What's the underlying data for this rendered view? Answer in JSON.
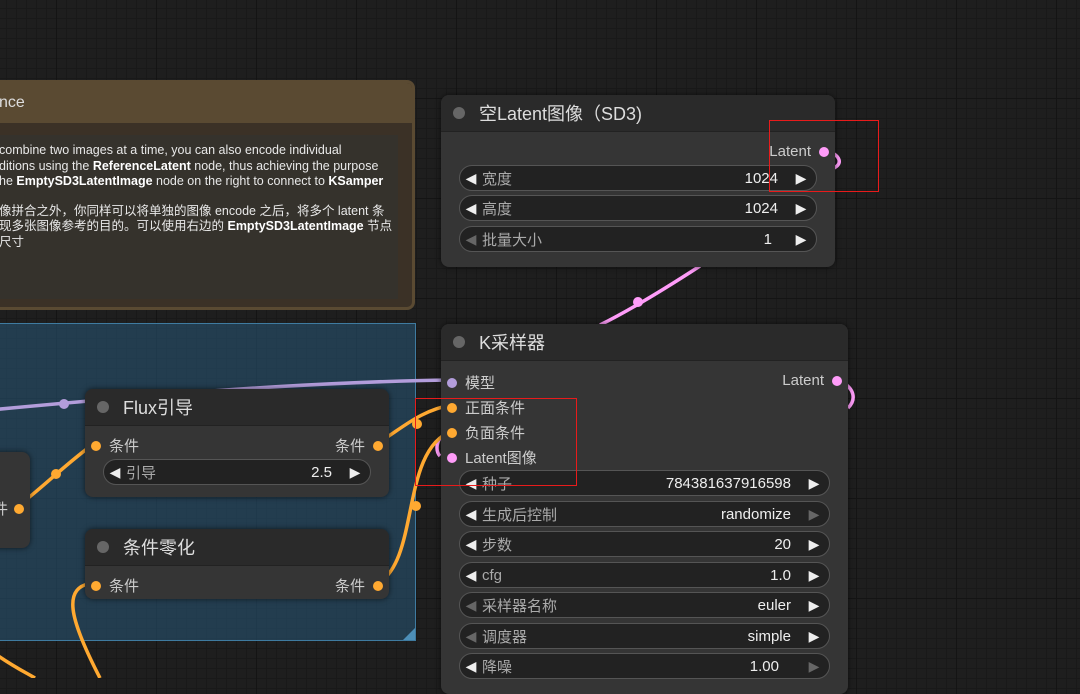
{
  "note": {
    "title": "nce",
    "en_lines": [
      " combine two images at a time, you can also encode individual",
      "ditions using the ",
      "he ",
      "node on the right to connect to "
    ],
    "en_bold": [
      "ReferenceLatent",
      "EmptySD3LatentImage",
      "KSamper"
    ],
    "en_line2_tail": " node, thus achieving the purpose",
    "zh_line1": "像拼合之外，你同样可以将单独的图像 encode 之后，将多个 latent 条",
    "zh_line2_pre": "现多张图像参考的目的。可以使用右边的 ",
    "zh_line2_bold": "EmptySD3LatentImage",
    "zh_line2_tail": " 节点",
    "zh_line3": "尺寸"
  },
  "empty_latent": {
    "title": "空Latent图像（SD3)",
    "output_label": "Latent",
    "widgets": [
      {
        "label": "宽度",
        "value": "1024"
      },
      {
        "label": "高度",
        "value": "1024"
      },
      {
        "label": "批量大小",
        "value": "1"
      }
    ]
  },
  "ksampler": {
    "title": "K采样器",
    "inputs": [
      "模型",
      "正面条件",
      "负面条件",
      "Latent图像"
    ],
    "output_label": "Latent",
    "widgets": [
      {
        "label": "种子",
        "value": "784381637916598"
      },
      {
        "label": "生成后控制",
        "value": "randomize"
      },
      {
        "label": "步数",
        "value": "20"
      },
      {
        "label": "cfg",
        "value": "1.0"
      },
      {
        "label": "采样器名称",
        "value": "euler"
      },
      {
        "label": "调度器",
        "value": "simple"
      },
      {
        "label": "降噪",
        "value": "1.00"
      }
    ]
  },
  "flux_guidance": {
    "title": "Flux引导",
    "input_label": "条件",
    "output_label": "条件",
    "widget": {
      "label": "引导",
      "value": "2.5"
    }
  },
  "cond_zero": {
    "title": "条件零化",
    "input_label": "条件",
    "output_label": "条件"
  },
  "partial_node": {
    "output_label": "件"
  },
  "colors": {
    "model": "#b39ddb",
    "conditioning": "#ffa931",
    "latent": "#ff9cf9",
    "highlight": "#e81b1b"
  }
}
